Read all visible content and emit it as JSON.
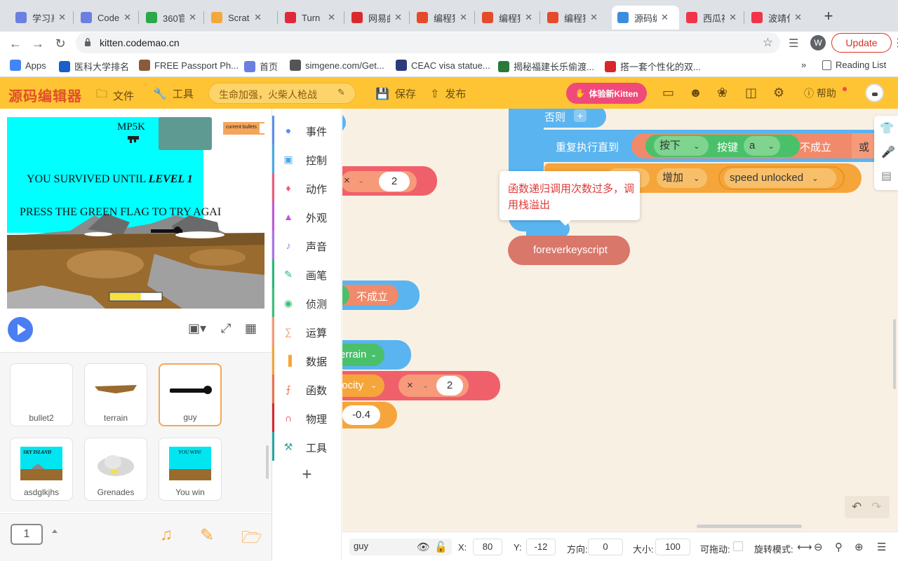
{
  "browser": {
    "tabs": [
      {
        "title": "学习系",
        "color": "#6b7fe0"
      },
      {
        "title": "Code",
        "color": "#6b7fe0"
      },
      {
        "title": "360官",
        "color": "#2aa84a"
      },
      {
        "title": "Scratc",
        "color": "#f2a93b"
      },
      {
        "title": "Turn",
        "color": "#e0283a"
      },
      {
        "title": "网易曲",
        "color": "#d82a2a"
      },
      {
        "title": "编程猫",
        "color": "#e44b2a"
      },
      {
        "title": "编程猫",
        "color": "#e44b2a"
      },
      {
        "title": "编程猫",
        "color": "#e44b2a"
      },
      {
        "title": "源码编",
        "color": "#3b8de0"
      },
      {
        "title": "西瓜视",
        "color": "#f0344a"
      },
      {
        "title": "波靖化",
        "color": "#f0344a"
      }
    ],
    "active_tab": 9,
    "url": "kitten.codemao.cn",
    "profile_initial": "W",
    "update_label": "Update",
    "bookmarks": [
      {
        "label": "Apps",
        "color": "#4285f4"
      },
      {
        "label": "医科大学排名",
        "color": "#1a5fc9"
      },
      {
        "label": "FREE Passport Ph...",
        "color": "#8a5a3a"
      },
      {
        "label": "首页",
        "color": "#6b7fe0"
      },
      {
        "label": "simgene.com/Get...",
        "color": "#555555"
      },
      {
        "label": "CEAC visa statue...",
        "color": "#2a3a7a"
      },
      {
        "label": "揭秘福建长乐偷渡...",
        "color": "#2a7a3a"
      },
      {
        "label": "搭一套个性化的双...",
        "color": "#d8262a"
      }
    ],
    "more_bookmarks": "»",
    "reading_list": "Reading List"
  },
  "app": {
    "logo": "源码编辑器",
    "file_label": "文件",
    "tools_label": "工具",
    "project_name": "生命加强，火柴人枪战",
    "save_label": "保存",
    "publish_label": "发布",
    "kitten_label": "体验新Kitten",
    "help_label": "帮助"
  },
  "stage": {
    "weapon_label": "MP5K",
    "hud_label": "current bullets",
    "survived_prefix": "YOU SURVIVED UNTIL ",
    "level_text": "LEVEL 1",
    "press_text": "PRESS THE GREEN FLAG TO TRY AGAI",
    "health_fraction": 0.6,
    "sky_color": "#00ffff",
    "ground_color": "#9a6b2e"
  },
  "sprites": [
    {
      "name": "bullet2"
    },
    {
      "name": "terrain"
    },
    {
      "name": "guy",
      "selected": true
    },
    {
      "name": "asdglkjhs",
      "thumb_text": "SKY ISLAND"
    },
    {
      "name": "Grenades"
    },
    {
      "name": "You win",
      "thumb_text": "YOU WIN!"
    }
  ],
  "scene_number": "1",
  "categories": [
    {
      "label": "事件",
      "color": "#5a8ef2"
    },
    {
      "label": "控制",
      "color": "#4aa8e8"
    },
    {
      "label": "动作",
      "color": "#f05a7a"
    },
    {
      "label": "外观",
      "color": "#c05ad8"
    },
    {
      "label": "声音",
      "color": "#a874e8"
    },
    {
      "label": "画笔",
      "color": "#2ab87a"
    },
    {
      "label": "侦测",
      "color": "#3ac07a"
    },
    {
      "label": "运算",
      "color": "#f59a7a"
    },
    {
      "label": "数据",
      "color": "#f5a53a"
    },
    {
      "label": "函数",
      "color": "#f0704a"
    },
    {
      "label": "物理",
      "color": "#d8262a"
    },
    {
      "label": "工具",
      "color": "#28a8a0"
    }
  ],
  "add_category": "+",
  "workspace": {
    "else_label": "否则",
    "else_add": "+",
    "repeat_until_label": "重复执行直到",
    "press_label": "按下",
    "key_label": "按键",
    "key_value": "a",
    "not_label": "不成立",
    "or_label": "或",
    "increase_label": "增加",
    "var_fragment": "x",
    "speed_var": "speed unlocked",
    "error_message": "函数递归调用次数过多，调用栈溢出",
    "func_name": "foreverkeyscript",
    "times_op": "×",
    "num_two": "2",
    "not_label_2": "不成立",
    "terrain_fragment": "errain",
    "velocity_fragment": "locity",
    "num_two_b": "2",
    "neg_value": "-0.4",
    "times_op_b": "×"
  },
  "props": {
    "sprite_name": "guy",
    "x_label": "X:",
    "x_value": "80",
    "y_label": "Y:",
    "y_value": "-12",
    "dir_label": "方向:",
    "dir_value": "0",
    "size_label": "大小:",
    "size_value": "100",
    "drag_label": "可拖动:",
    "rotate_label": "旋转模式:"
  }
}
